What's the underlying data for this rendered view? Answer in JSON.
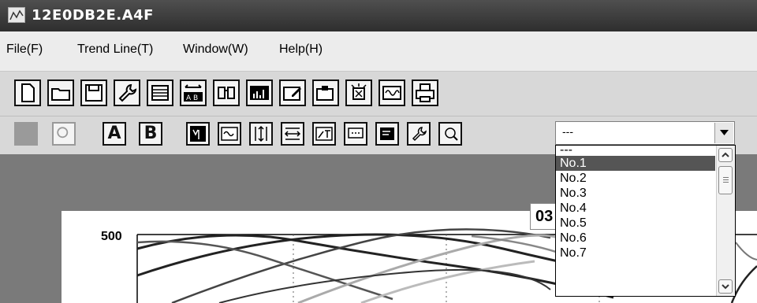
{
  "window": {
    "title": "12E0DB2E.A4F",
    "icon": "trend-chart-icon"
  },
  "menu": [
    {
      "label": "File(F)"
    },
    {
      "label": "Trend Line(T)"
    },
    {
      "label": "Window(W)"
    },
    {
      "label": "Help(H)"
    }
  ],
  "toolbar1": {
    "buttons": [
      "new-file-icon",
      "open-folder-icon",
      "save-disk-icon",
      "wrench-icon",
      "table-icon",
      "ab-compare-icon",
      "binoculars-icon",
      "bar-chart-icon",
      "edit-chart-icon",
      "chart-tool-icon",
      "alarm-icon",
      "waveform-icon",
      "print-icon"
    ]
  },
  "toolbar2": {
    "a_label": "A",
    "b_label": "B",
    "combo": {
      "value": "---",
      "arrow": "chevron-down-icon"
    }
  },
  "dropdown": {
    "items": [
      "---",
      "No.1",
      "No.2",
      "No.3",
      "No.4",
      "No.5",
      "No.6",
      "No.7"
    ],
    "selected": "No.1"
  },
  "chart": {
    "y_tick_label": "500",
    "overlay_label": "03"
  },
  "colors": {
    "selection": "#555555",
    "titlebar": "#3c3c3c",
    "workspace": "#7a7a7a"
  }
}
